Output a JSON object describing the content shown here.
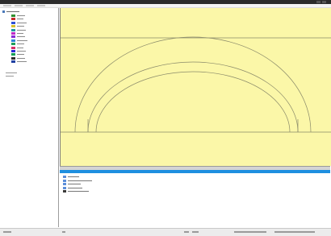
{
  "tree": {
    "items": [
      {
        "color": "#2f8f2f"
      },
      {
        "color": "#c62b2b"
      },
      {
        "color": "#2c4fd6"
      },
      {
        "color": "#d6c12c"
      },
      {
        "color": "#1f9aa0"
      },
      {
        "color": "#c02ac6"
      },
      {
        "color": "#8a2bd6"
      },
      {
        "color": "#2c86d6"
      },
      {
        "color": "#1fa05a"
      },
      {
        "color": "#d62c6a"
      },
      {
        "color": "#2a2ad6"
      },
      {
        "color": "#0e9e56"
      },
      {
        "color": "#2c2c2c"
      },
      {
        "color": "#1f3fa0"
      }
    ]
  },
  "output": {
    "tab_label": "",
    "messages": [
      {
        "icon_color": "#5b8dd9"
      },
      {
        "icon_color": "#5b8dd9"
      },
      {
        "icon_color": "#5b8dd9"
      },
      {
        "icon_color": "#5b8dd9"
      },
      {
        "icon_color": "#3a3a3a"
      }
    ]
  },
  "colors": {
    "drawing_background": "#fbf7a8",
    "accent": "#1e8fe0",
    "outline": "#8a8a6a"
  }
}
